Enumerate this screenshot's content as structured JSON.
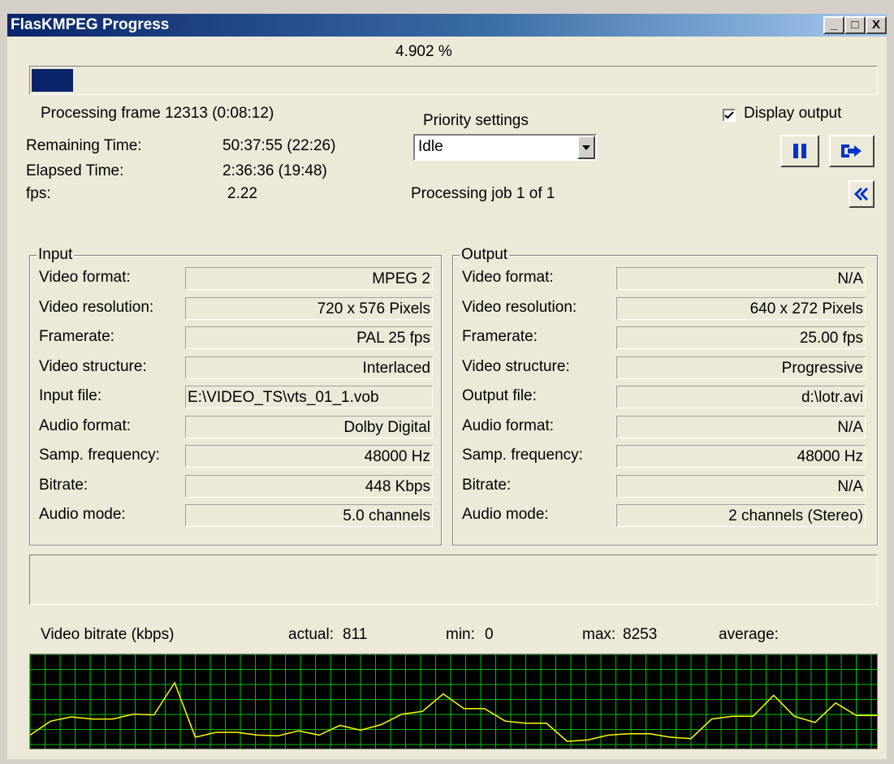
{
  "window": {
    "title": "FlasKMPEG Progress",
    "minimize_label": "_",
    "maximize_label": "□",
    "close_label": "X"
  },
  "progress": {
    "percent_text": "4.902 %",
    "fraction": 0.04902,
    "frame_text": "Processing frame 12313 (0:08:12)"
  },
  "stats": {
    "remaining_label": "Remaining Time:",
    "remaining_value": "50:37:55 (22:26)",
    "elapsed_label": "Elapsed Time:",
    "elapsed_value": "2:36:36 (19:48)",
    "fps_label": "fps:",
    "fps_value": "2.22"
  },
  "priority": {
    "label": "Priority settings",
    "selected": "Idle",
    "job_text": "Processing job 1 of 1"
  },
  "display_output": {
    "label": "Display output",
    "checked": true
  },
  "input": {
    "legend": "Input",
    "rows": [
      {
        "label": "Video format:",
        "value": "MPEG 2"
      },
      {
        "label": "Video resolution:",
        "value": "720 x 576 Pixels"
      },
      {
        "label": "Framerate:",
        "value": "PAL 25 fps"
      },
      {
        "label": "Video structure:",
        "value": "Interlaced"
      },
      {
        "label": "Input file:",
        "value": "E:\\VIDEO_TS\\vts_01_1.vob"
      },
      {
        "label": "Audio format:",
        "value": "Dolby Digital"
      },
      {
        "label": "Samp. frequency:",
        "value": "48000 Hz"
      },
      {
        "label": "Bitrate:",
        "value": "448 Kbps"
      },
      {
        "label": "Audio mode:",
        "value": "5.0 channels"
      }
    ]
  },
  "output": {
    "legend": "Output",
    "rows": [
      {
        "label": "Video format:",
        "value": "N/A"
      },
      {
        "label": "Video resolution:",
        "value": "640 x 272 Pixels"
      },
      {
        "label": "Framerate:",
        "value": "25.00 fps"
      },
      {
        "label": "Video structure:",
        "value": "Progressive"
      },
      {
        "label": "Output file:",
        "value": "d:\\lotr.avi"
      },
      {
        "label": "Audio format:",
        "value": "N/A"
      },
      {
        "label": "Samp. frequency:",
        "value": "48000 Hz"
      },
      {
        "label": "Bitrate:",
        "value": "N/A"
      },
      {
        "label": "Audio mode:",
        "value": "2 channels (Stereo)"
      }
    ]
  },
  "bitrate": {
    "title": "Video bitrate (kbps)",
    "actual_label": "actual:",
    "actual_value": "811",
    "min_label": "min:",
    "min_value": "0",
    "max_label": "max:",
    "max_value": "8253",
    "average_label": "average:",
    "average_value": ""
  },
  "graph": {
    "values": [
      0.1,
      0.3,
      0.36,
      0.33,
      0.33,
      0.4,
      0.39,
      0.85,
      0.07,
      0.14,
      0.14,
      0.1,
      0.09,
      0.16,
      0.1,
      0.24,
      0.17,
      0.25,
      0.4,
      0.44,
      0.69,
      0.48,
      0.48,
      0.3,
      0.27,
      0.27,
      0.01,
      0.03,
      0.1,
      0.12,
      0.12,
      0.07,
      0.05,
      0.33,
      0.37,
      0.37,
      0.67,
      0.37,
      0.28,
      0.56,
      0.38,
      0.38
    ],
    "line_color": "#ffff00",
    "grid_color": "#00c000",
    "bg_color": "#000000"
  },
  "colors": {
    "progress_fill": "#0a246a",
    "button_icon": "#0033cc"
  }
}
